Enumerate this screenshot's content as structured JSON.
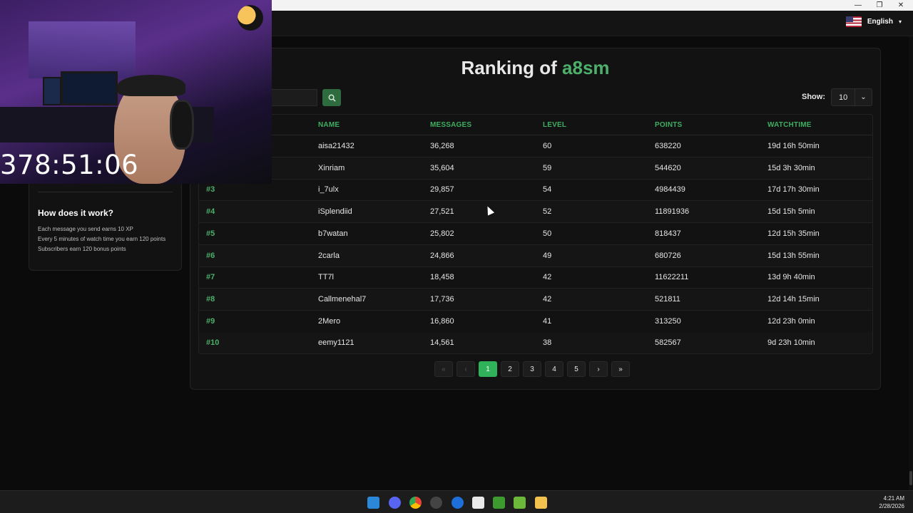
{
  "window": {
    "controls": [
      "—",
      "❐",
      "✕"
    ]
  },
  "header": {
    "language": "English",
    "flag_icon": "us-flag-icon"
  },
  "sidebar": {
    "how_title": "How does it work?",
    "how_lines": [
      "Each message you send earns 10 XP",
      "Every 5 minutes of watch time you earn 120 points",
      "Subscribers earn 120 bonus points"
    ]
  },
  "main": {
    "heading_prefix": "Ranking of",
    "channel": "a8sm",
    "show_label": "Show:",
    "show_value": "10",
    "search_icon": "search-icon",
    "columns": [
      "NAME",
      "MESSAGES",
      "LEVEL",
      "POINTS",
      "WATCHTIME"
    ],
    "rows": [
      {
        "rank": "",
        "name": "aisa21432",
        "messages": "36,268",
        "level": "60",
        "points": "638220",
        "watchtime": "19d 16h 50min"
      },
      {
        "rank": "",
        "name": "Xinriam",
        "messages": "35,604",
        "level": "59",
        "points": "544620",
        "watchtime": "15d 3h 30min"
      },
      {
        "rank": "#3",
        "name": "i_7ulx",
        "messages": "29,857",
        "level": "54",
        "points": "4984439",
        "watchtime": "17d 17h 30min"
      },
      {
        "rank": "#4",
        "name": "iSplendiid",
        "messages": "27,521",
        "level": "52",
        "points": "11891936",
        "watchtime": "15d 15h 5min"
      },
      {
        "rank": "#5",
        "name": "b7watan",
        "messages": "25,802",
        "level": "50",
        "points": "818437",
        "watchtime": "12d 15h 35min"
      },
      {
        "rank": "#6",
        "name": "2carla",
        "messages": "24,866",
        "level": "49",
        "points": "680726",
        "watchtime": "15d 13h 55min"
      },
      {
        "rank": "#7",
        "name": "TT7l",
        "messages": "18,458",
        "level": "42",
        "points": "11622211",
        "watchtime": "13d 9h 40min"
      },
      {
        "rank": "#8",
        "name": "Callmenehal7",
        "messages": "17,736",
        "level": "42",
        "points": "521811",
        "watchtime": "12d 14h 15min"
      },
      {
        "rank": "#9",
        "name": "2Mero",
        "messages": "16,860",
        "level": "41",
        "points": "313250",
        "watchtime": "12d 23h 0min"
      },
      {
        "rank": "#10",
        "name": "eemy1121",
        "messages": "14,561",
        "level": "38",
        "points": "582567",
        "watchtime": "9d 23h 10min"
      }
    ],
    "pagination": {
      "first": "«",
      "prev": "‹",
      "pages": [
        "1",
        "2",
        "3",
        "4",
        "5"
      ],
      "active": "1",
      "next": "›",
      "last": "»"
    }
  },
  "overlay": {
    "timer": "378:51:06"
  },
  "taskbar": {
    "time": "4:21 AM",
    "date": "2/28/2026"
  }
}
